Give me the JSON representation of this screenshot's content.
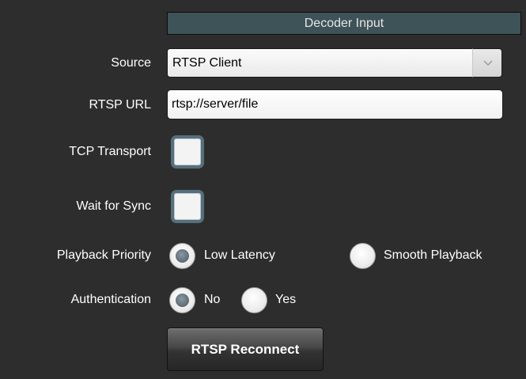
{
  "header": {
    "title": "Decoder Input"
  },
  "source": {
    "label": "Source",
    "selected": "RTSP Client"
  },
  "rtsp_url": {
    "label": "RTSP URL",
    "value": "rtsp://server/file"
  },
  "tcp_transport": {
    "label": "TCP Transport",
    "checked": false
  },
  "wait_for_sync": {
    "label": "Wait for Sync",
    "checked": false
  },
  "playback_priority": {
    "label": "Playback Priority",
    "options": [
      {
        "label": "Low Latency",
        "selected": true
      },
      {
        "label": "Smooth Playback",
        "selected": false
      }
    ]
  },
  "authentication": {
    "label": "Authentication",
    "options": [
      {
        "label": "No",
        "selected": true
      },
      {
        "label": "Yes",
        "selected": false
      }
    ]
  },
  "reconnect_button": {
    "label": "RTSP Reconnect"
  },
  "icons": {
    "dropdown": "chevron-down-icon"
  },
  "colors": {
    "background": "#2d2d2d",
    "header": "#3e5358",
    "checkbox_border": "#556f7d",
    "radio_selected": "#5d6a73"
  }
}
